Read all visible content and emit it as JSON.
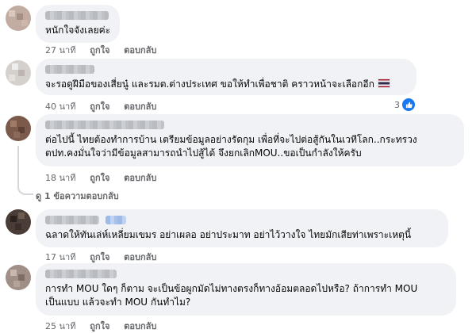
{
  "comments": [
    {
      "text_lines": [
        "หนักใจจังเลยค่ะ"
      ],
      "time": "27 นาที",
      "like": "ถูกใจ",
      "reply": "ตอบกลับ"
    },
    {
      "text_lines": [
        "จะรอดูฝีมือของเสี่ยนู๋ และรมต.ต่างประเทศ ขอให้ทำเพื่อชาติ คราวหน้าจะเลือกอีก"
      ],
      "emoji": "thai-flag",
      "time": "40 นาที",
      "like": "ถูกใจ",
      "reply": "ตอบกลับ",
      "reaction_count": "3",
      "reaction_icon": "thumbs-up-icon"
    },
    {
      "text_lines": [
        "ต่อไปนี้ ไทยต้องทำการบ้าน เตรียมข้อมูลอย่างรัดกุม เพื่อที่จะไปต่อสู้กันในเวทีโลก..กระทรวง",
        "ตปท.คงมั่นใจว่ามีข้อมูลสามารถนำไปสู้ได้ จึงยกเลิกMOU..ขอเป็นกำลังให้ครับ"
      ],
      "time": "18 นาที",
      "like": "ถูกใจ",
      "reply": "ตอบกลับ",
      "view_replies": "ดู 1 ข้อความตอบกลับ"
    },
    {
      "text_lines": [
        "ฉลาดให้ทันเล่ห์เหลี่ยมเขมร อย่าเผลอ อย่าประมาท อย่าไว้วางใจ ไทยมักเสียท่าเพราะเหตุนี้"
      ],
      "time": "17 นาที",
      "like": "ถูกใจ",
      "reply": "ตอบกลับ"
    },
    {
      "text_lines": [
        "การทำ MOU ใดๆ ก็ตาม จะเป็นข้อผูกมัดไม่ทางตรงก็ทางอ้อมตลอดไปหรือ? ถ้าการทำ MOU",
        "เป็นแบบ แล้วจะทำ MOU กันทำไม?"
      ],
      "time": "25 นาที",
      "like": "ถูกใจ",
      "reply": "ตอบกลับ"
    }
  ],
  "colors": {
    "bubble": "#f0f2f5",
    "meta_text": "#65676b",
    "reaction": "#1877f2"
  }
}
